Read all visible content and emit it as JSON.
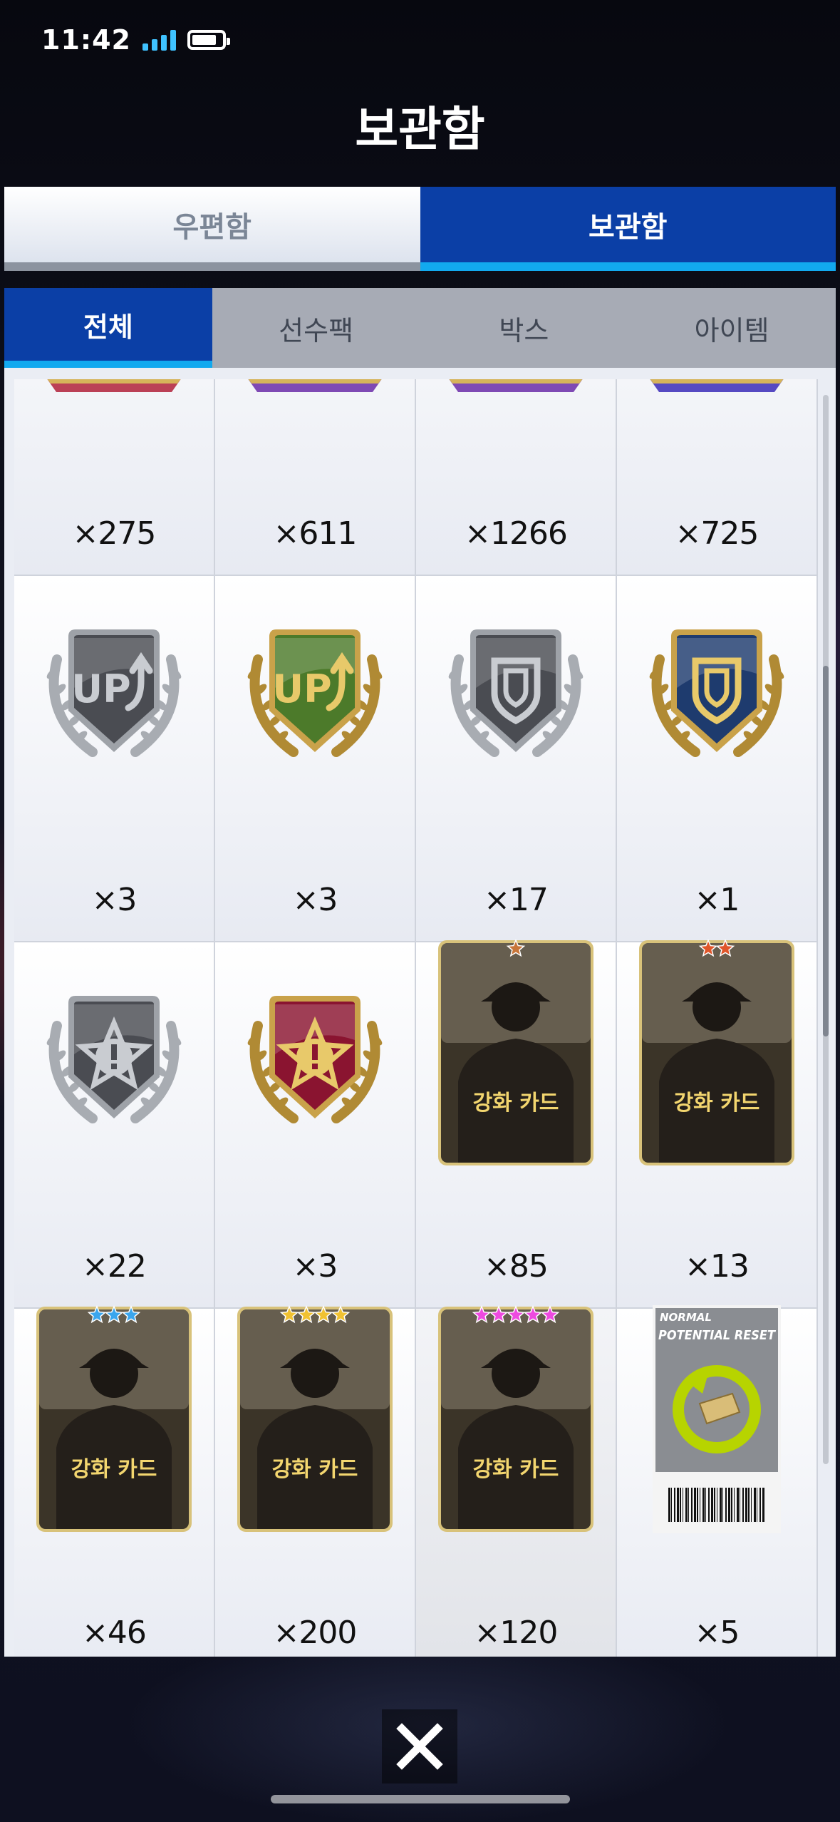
{
  "status_bar": {
    "time": "11:42"
  },
  "header": {
    "title": "보관함"
  },
  "main_tabs": [
    {
      "label": "우편함",
      "active": false
    },
    {
      "label": "보관함",
      "active": true
    }
  ],
  "sub_tabs": [
    {
      "label": "전체",
      "active": true
    },
    {
      "label": "선수팩",
      "active": false
    },
    {
      "label": "박스",
      "active": false
    },
    {
      "label": "아이템",
      "active": false
    }
  ],
  "items": [
    {
      "icon": "partial-item-icon",
      "count": "×275"
    },
    {
      "icon": "partial-item-icon",
      "count": "×611"
    },
    {
      "icon": "partial-item-icon",
      "count": "×1266"
    },
    {
      "icon": "partial-item-icon",
      "count": "×725"
    },
    {
      "icon": "silver-up-badge-icon",
      "count": "×3"
    },
    {
      "icon": "gold-up-badge-icon",
      "count": "×3"
    },
    {
      "icon": "silver-shield-badge-icon",
      "count": "×17"
    },
    {
      "icon": "gold-shield-badge-icon",
      "count": "×1"
    },
    {
      "icon": "silver-alert-badge-icon",
      "count": "×22"
    },
    {
      "icon": "gold-alert-badge-icon",
      "count": "×3"
    },
    {
      "icon": "enhance-card-1star-icon",
      "count": "×85",
      "label": "강화 카드",
      "stars": 1
    },
    {
      "icon": "enhance-card-2star-icon",
      "count": "×13",
      "label": "강화 카드",
      "stars": 2
    },
    {
      "icon": "enhance-card-3star-icon",
      "count": "×46",
      "label": "강화 카드",
      "stars": 3
    },
    {
      "icon": "enhance-card-4star-icon",
      "count": "×200",
      "label": "강화 카드",
      "stars": 4
    },
    {
      "icon": "enhance-card-5star-icon",
      "count": "×120",
      "label": "강화 카드",
      "stars": 5
    },
    {
      "icon": "potential-reset-ticket-icon",
      "count": "×5",
      "ticket_line1": "NORMAL",
      "ticket_line2": "POTENTIAL RESET"
    }
  ],
  "colors": {
    "tab_active": "#0b3fa6",
    "tab_underline": "#12a9ef",
    "star_1": "#c8763a",
    "star_2": "#e0562a",
    "star_3": "#3aa6ee",
    "star_4": "#f1c232",
    "star_5": "#ee4ae0"
  }
}
